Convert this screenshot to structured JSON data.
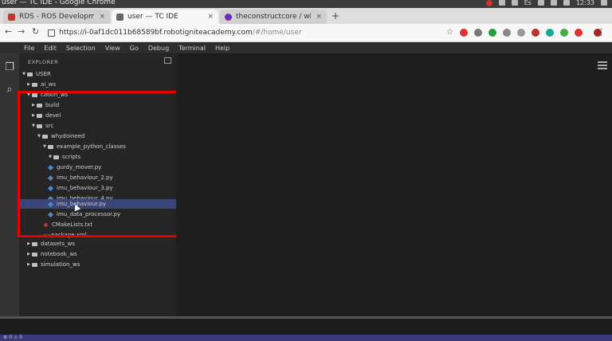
{
  "window": {
    "title": "user — TC IDE - Google Chrome",
    "clock": "12:33",
    "keyboard_layout": "Es"
  },
  "tabs": [
    {
      "label": "RDS - ROS Development S",
      "favicon_color": "#c0392b"
    },
    {
      "label": "user — TC IDE",
      "favicon_color": "#666666"
    },
    {
      "label": "theconstructcore / whyd",
      "favicon_color": "#6a2fb5"
    }
  ],
  "newtab_label": "+",
  "address_bar": {
    "url_main": "https://i-0af1dc011b68589bf.robotigniteacademy.com",
    "url_path": "/#/home/user"
  },
  "menu": [
    "File",
    "Edit",
    "Selection",
    "View",
    "Go",
    "Debug",
    "Terminal",
    "Help"
  ],
  "explorer": {
    "title": "EXPLORER",
    "items": [
      {
        "label": "USER",
        "type": "folder",
        "expanded": true
      },
      {
        "label": "ai_ws",
        "type": "folder",
        "expanded": false
      },
      {
        "label": "catkin_ws",
        "type": "folder",
        "expanded": true
      },
      {
        "label": "build",
        "type": "folder",
        "expanded": false
      },
      {
        "label": "devel",
        "type": "folder",
        "expanded": false
      },
      {
        "label": "src",
        "type": "folder",
        "expanded": true
      },
      {
        "label": "whydoineed",
        "type": "folder",
        "expanded": true
      },
      {
        "label": "example_python_classes",
        "type": "folder",
        "expanded": true
      },
      {
        "label": "scripts",
        "type": "folder",
        "expanded": true
      },
      {
        "label": "gurdy_mover.py",
        "type": "python"
      },
      {
        "label": "imu_behaviour_2.py",
        "type": "python"
      },
      {
        "label": "imu_behaviour_3.py",
        "type": "python"
      },
      {
        "label": "imu_behaviour_4.py",
        "type": "python"
      },
      {
        "label": "imu_behaviour.py",
        "type": "python",
        "selected": true
      },
      {
        "label": "imu_data_processor.py",
        "type": "python"
      },
      {
        "label": "CMakeLists.txt",
        "type": "cmake"
      },
      {
        "label": "package.xml",
        "type": "xml"
      },
      {
        "label": "datasets_ws",
        "type": "folder",
        "expanded": false
      },
      {
        "label": "notebook_ws",
        "type": "folder",
        "expanded": false
      },
      {
        "label": "simulation_ws",
        "type": "folder",
        "expanded": false
      }
    ]
  },
  "status_bar": {
    "text": "⚙ 0 ⚠ 0"
  },
  "colors": {
    "highlight_box": "#e80000",
    "selection": "#3c4577",
    "status_bar": "#3a3a7a"
  }
}
